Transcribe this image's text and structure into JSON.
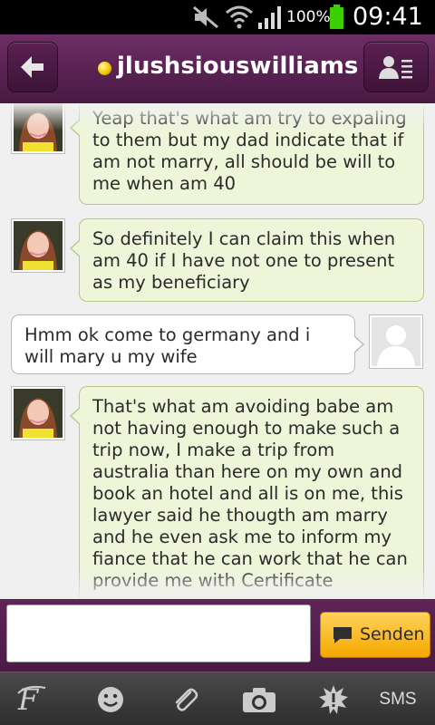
{
  "status_bar": {
    "battery_percent": "100%",
    "time": "09:41",
    "icons": [
      "mute-icon",
      "wifi-icon",
      "signal-icon",
      "battery-icon"
    ]
  },
  "header": {
    "contact_name": "jlushsiouswilliams",
    "status_color": "#f0c800",
    "back_icon": "back-arrow-icon",
    "contact_icon": "contact-list-icon"
  },
  "messages": [
    {
      "direction": "in",
      "text": "Yeap that's what am try to expaling to them but my dad indicate that if am not marry, all should be will to me when am 40"
    },
    {
      "direction": "in",
      "text": "So definitely I can claim this when am 40 if I have not one to present as my beneficiary"
    },
    {
      "direction": "out",
      "text": "Hmm ok come to germany and i will mary u my wife"
    },
    {
      "direction": "in",
      "text": "That's what am avoiding babe am not having enough to make such a trip now, I make a trip from australia than here on my own and book an hotel and all is on me, this lawyer said he thougth am marry and he even ask me to inform my fiance that he can work that he can provide me with Certificate"
    }
  ],
  "composer": {
    "input_value": "",
    "input_placeholder": "",
    "send_label": "Senden"
  },
  "toolbar": {
    "items": [
      "font-icon",
      "emoji-icon",
      "attach-icon",
      "camera-icon",
      "alert-icon"
    ],
    "sms_label": "SMS"
  },
  "colors": {
    "header": "#5a2253",
    "incoming_bubble": "#eef5d9",
    "outgoing_bubble": "#ffffff",
    "send_button": "#f5b800"
  }
}
